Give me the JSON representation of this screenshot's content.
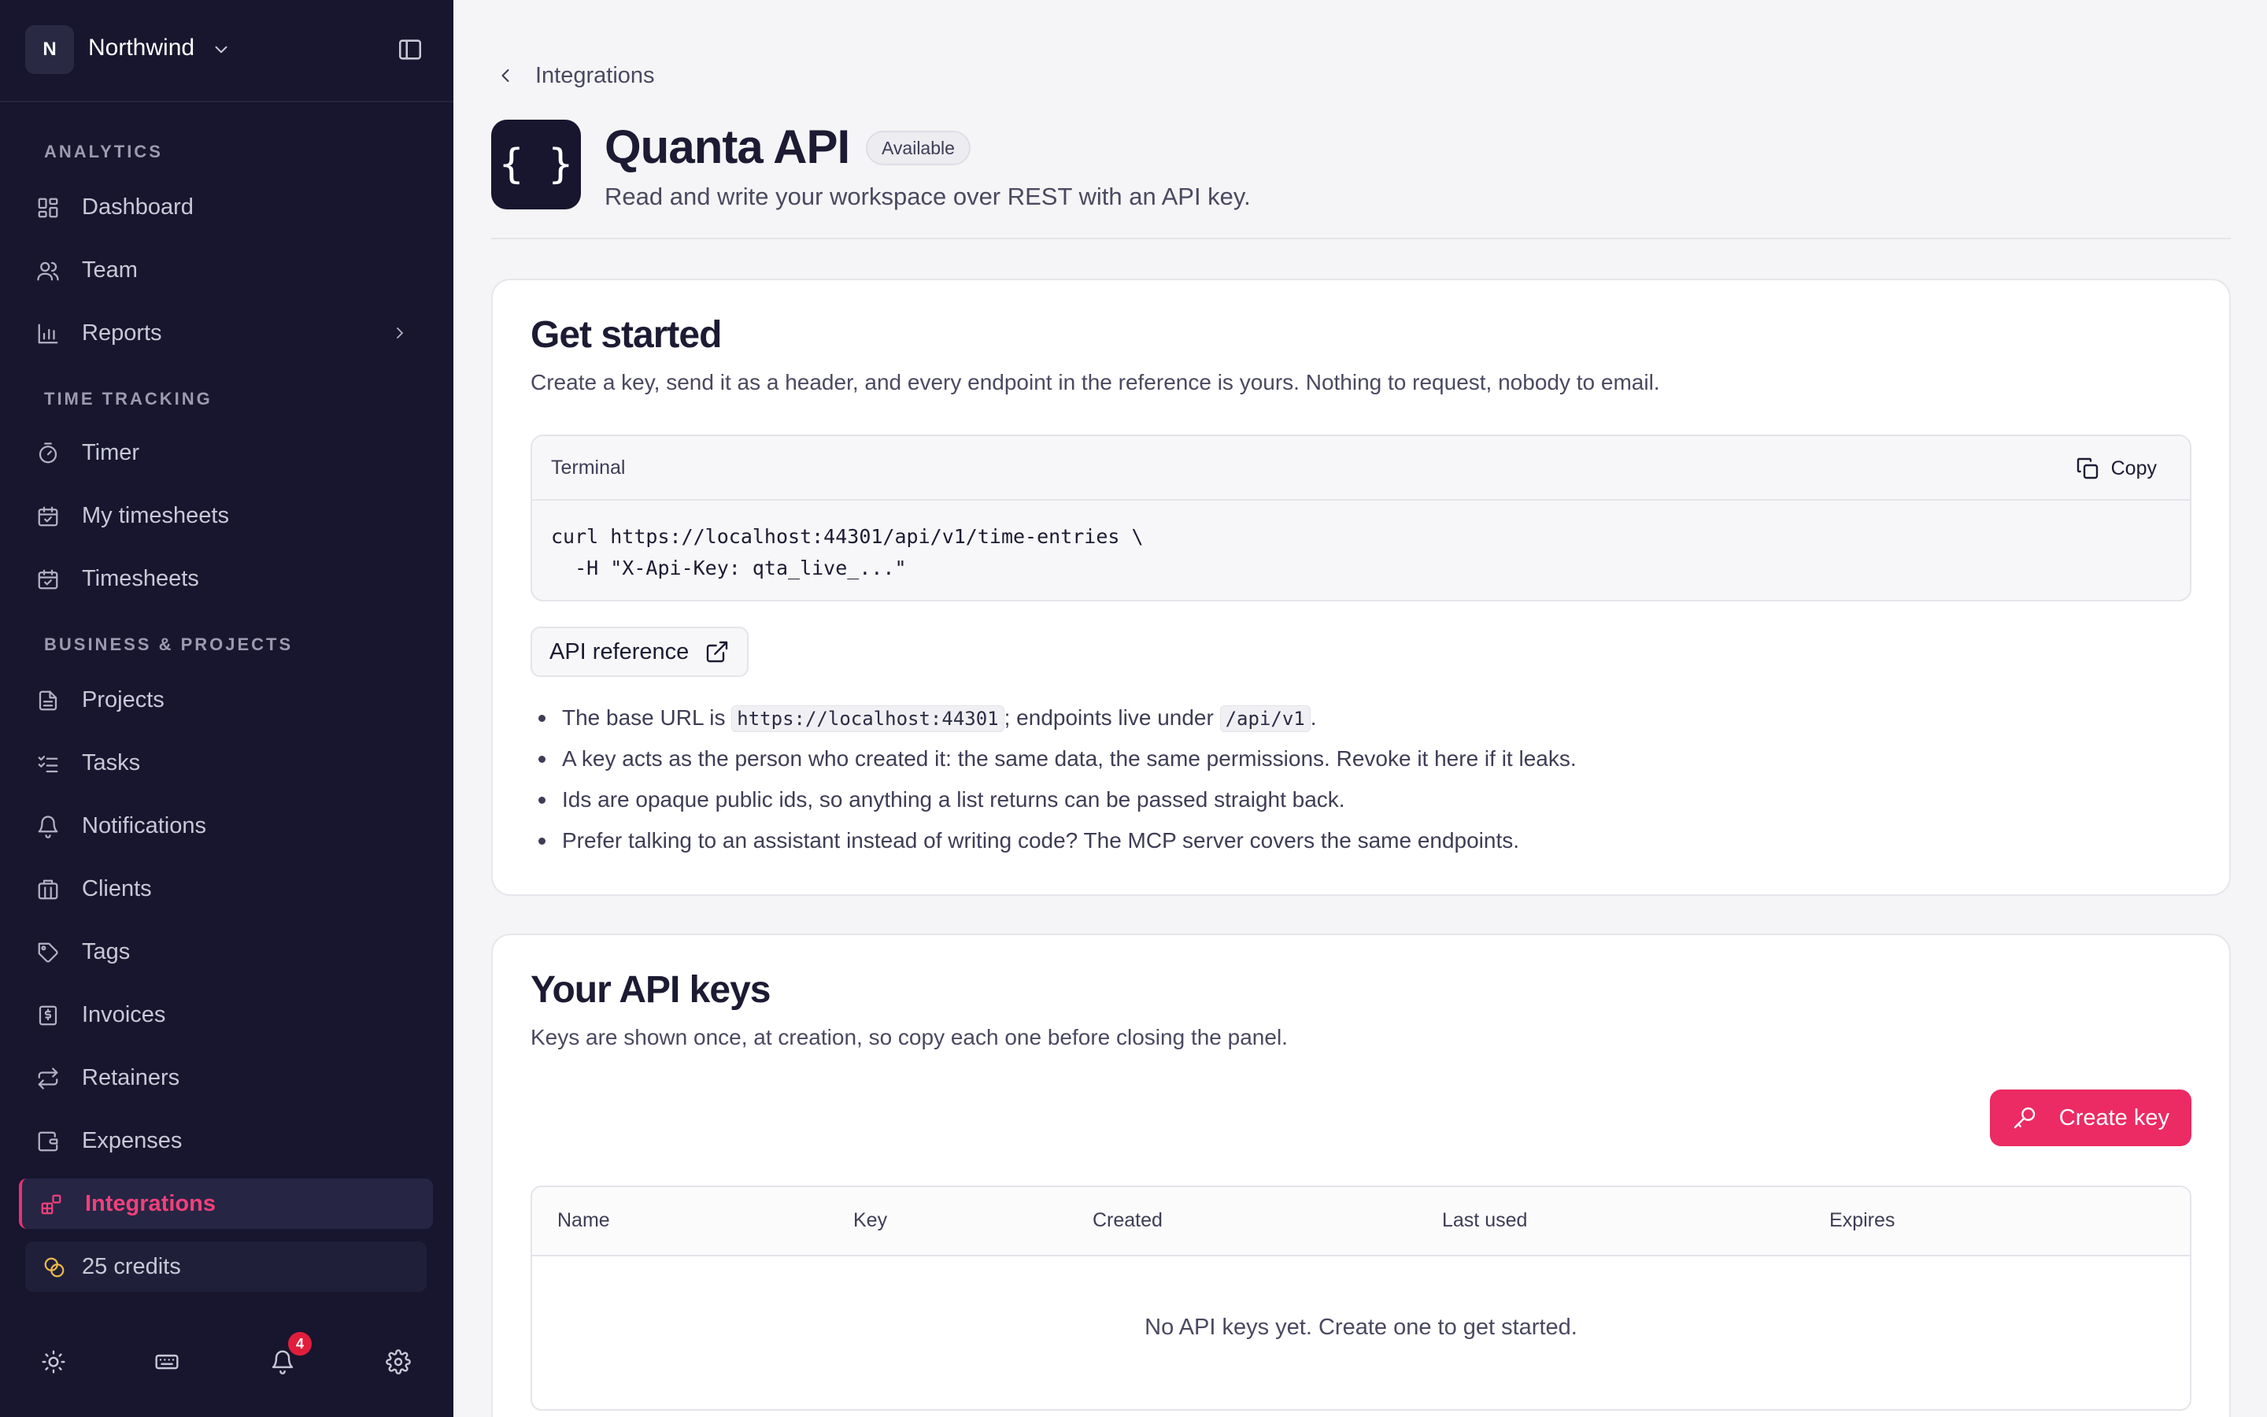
{
  "workspace": {
    "initial": "N",
    "name": "Northwind"
  },
  "sidebar": {
    "sections": [
      {
        "label": "ANALYTICS"
      },
      {
        "label": "TIME TRACKING"
      },
      {
        "label": "BUSINESS & PROJECTS"
      }
    ],
    "items": [
      {
        "label": "Dashboard",
        "icon": "dashboard-icon"
      },
      {
        "label": "Team",
        "icon": "team-icon"
      },
      {
        "label": "Reports",
        "icon": "reports-icon"
      },
      {
        "label": "Timer",
        "icon": "timer-icon"
      },
      {
        "label": "My timesheets",
        "icon": "calendar-check-icon"
      },
      {
        "label": "Timesheets",
        "icon": "calendar-check-icon"
      },
      {
        "label": "Projects",
        "icon": "document-icon"
      },
      {
        "label": "Tasks",
        "icon": "checklist-icon"
      },
      {
        "label": "Notifications",
        "icon": "bell-icon"
      },
      {
        "label": "Clients",
        "icon": "building-icon"
      },
      {
        "label": "Tags",
        "icon": "tag-icon"
      },
      {
        "label": "Invoices",
        "icon": "invoice-icon"
      },
      {
        "label": "Retainers",
        "icon": "repeat-icon"
      },
      {
        "label": "Expenses",
        "icon": "wallet-icon"
      },
      {
        "label": "Integrations",
        "icon": "integrations-icon"
      },
      {
        "label": "25 credits",
        "icon": "coins-icon"
      }
    ],
    "active_item": "Integrations",
    "notification_count": "4",
    "colors": {
      "background": "#17162e",
      "accent": "#e6336f"
    }
  },
  "breadcrumb": {
    "label": "Integrations"
  },
  "app": {
    "icon_text": "{ }",
    "title": "Quanta API",
    "status": "Available",
    "subtitle": "Read and write your workspace over REST with an API key."
  },
  "get_started": {
    "title": "Get started",
    "description": "Create a key, send it as a header, and every endpoint in the reference is yours. Nothing to request, nobody to email.",
    "terminal": {
      "label": "Terminal",
      "copy_label": "Copy",
      "line1": "curl https://localhost:44301/api/v1/time-entries \\",
      "line2": "  -H \"X-Api-Key: qta_live_...\""
    },
    "reference_label": "API reference",
    "bullet1": {
      "prefix": "The base URL is",
      "base_url": "https://localhost:44301",
      "middle": "; endpoints live under",
      "path": "/api/v1",
      "suffix": "."
    },
    "bullet2": "A key acts as the person who created it: the same data, the same permissions. Revoke it here if it leaks.",
    "bullet3": "Ids are opaque public ids, so anything a list returns can be passed straight back.",
    "bullet4": "Prefer talking to an assistant instead of writing code? The MCP server covers the same endpoints."
  },
  "api_keys": {
    "title": "Your API keys",
    "description": "Keys are shown once, at creation, so copy each one before closing the panel.",
    "create_label": "Create key",
    "columns": [
      "Name",
      "Key",
      "Created",
      "Last used",
      "Expires"
    ],
    "empty_message": "No API keys yet. Create one to get started.",
    "accent": "#ec2a64"
  }
}
